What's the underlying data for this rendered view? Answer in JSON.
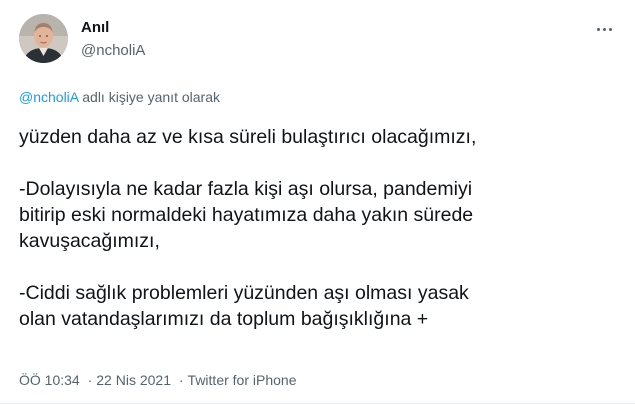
{
  "author": {
    "name": "Anıl",
    "handle": "@ncholiA"
  },
  "reply": {
    "mention": "@ncholiA",
    "suffix": "adlı kişiye yanıt olarak"
  },
  "body": {
    "line1": "yüzden daha az ve kısa süreli bulaştırıcı olacağımızı,",
    "para2_line1": "-Dolayısıyla ne kadar fazla kişi aşı olursa, pandemiyi",
    "para2_line2": "bitirip eski normaldeki hayatımıza daha yakın sürede",
    "para2_line3": "kavuşacağımızı,",
    "para3_line1": "-Ciddi sağlık problemleri yüzünden aşı olması yasak",
    "para3_line2": "olan vatandaşlarımızı da toplum bağışıklığına +"
  },
  "meta": {
    "time": "ÖÖ 10:34",
    "separator": "·",
    "date": "22 Nis 2021",
    "source": "Twitter for iPhone"
  },
  "colors": {
    "text": "#0f1419",
    "secondary": "#536471",
    "accent": "#1d9bf0"
  }
}
